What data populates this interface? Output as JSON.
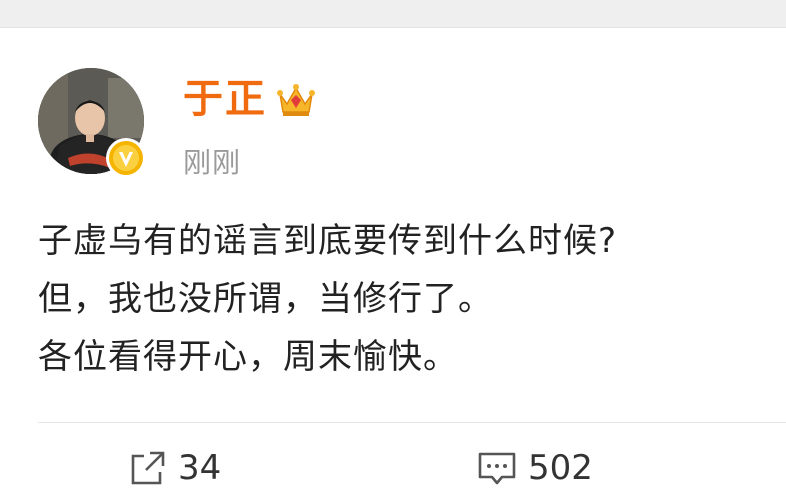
{
  "post": {
    "author": "于正",
    "time": "刚刚",
    "lines": [
      "子虚乌有的谣言到底要传到什么时候?",
      "但，我也没所谓，当修行了。",
      "各位看得开心，周末愉快。"
    ]
  },
  "actions": {
    "share_count": "34",
    "comment_count": "502"
  },
  "icons": {
    "verified": "verified-badge-icon",
    "crown": "vip-crown-icon",
    "share": "share-icon",
    "comment": "comment-icon"
  },
  "colors": {
    "username": "#f06a10",
    "verified": "#f5b400",
    "time": "#9a9a9a",
    "text": "#222222"
  }
}
